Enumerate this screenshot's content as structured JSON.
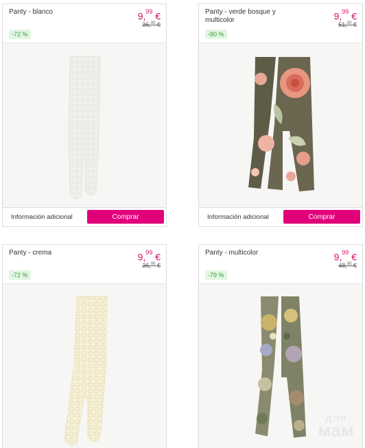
{
  "products": [
    {
      "name": "Panty - blanco",
      "price_main": "9,",
      "price_cents": "99",
      "price_cur": " €",
      "old_main": "36,",
      "old_cents": "00",
      "old_cur": " €",
      "discount": "-72 %",
      "info_label": "Información adicional",
      "buy_label": "Comprar"
    },
    {
      "name": "Panty - verde bosque y multicolor",
      "price_main": "9,",
      "price_cents": "99",
      "price_cur": " €",
      "old_main": "51,",
      "old_cents": "00",
      "old_cur": " €",
      "discount": "-80 %",
      "info_label": "Información adicional",
      "buy_label": "Comprar"
    },
    {
      "name": "Panty - crema",
      "price_main": "9,",
      "price_cents": "99",
      "price_cur": " €",
      "old_main": "36,",
      "old_cents": "00",
      "old_cur": " €",
      "discount": "-72 %"
    },
    {
      "name": "Panty - multicolor",
      "price_main": "9,",
      "price_cents": "99",
      "price_cur": " €",
      "old_main": "48,",
      "old_cents": "00",
      "old_cur": " €",
      "discount": "-79 %"
    }
  ],
  "watermark": {
    "line1": "для",
    "line2": "мам"
  },
  "colors": {
    "accent": "#e2007a",
    "price": "#d6106d",
    "discount_bg": "#e3f6e3",
    "discount_text": "#3b9b3b"
  }
}
